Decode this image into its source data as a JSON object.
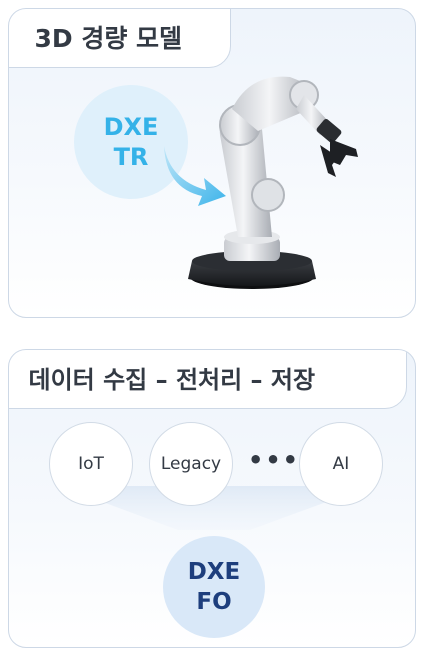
{
  "model_panel": {
    "title": "3D 경량 모델",
    "badge_line1": "DXE",
    "badge_line2": "TR",
    "robot_icon": "robotic-arm-icon"
  },
  "data_panel": {
    "title": "데이터 수집 – 전처리 – 저장",
    "sources": [
      "IoT",
      "Legacy",
      "AI"
    ],
    "ellipsis": "•••",
    "target_line1": "DXE",
    "target_line2": "FO"
  },
  "colors": {
    "tr_accent": "#34b2e8",
    "fo_accent": "#1d3e7d",
    "border": "#cdd8e6"
  }
}
